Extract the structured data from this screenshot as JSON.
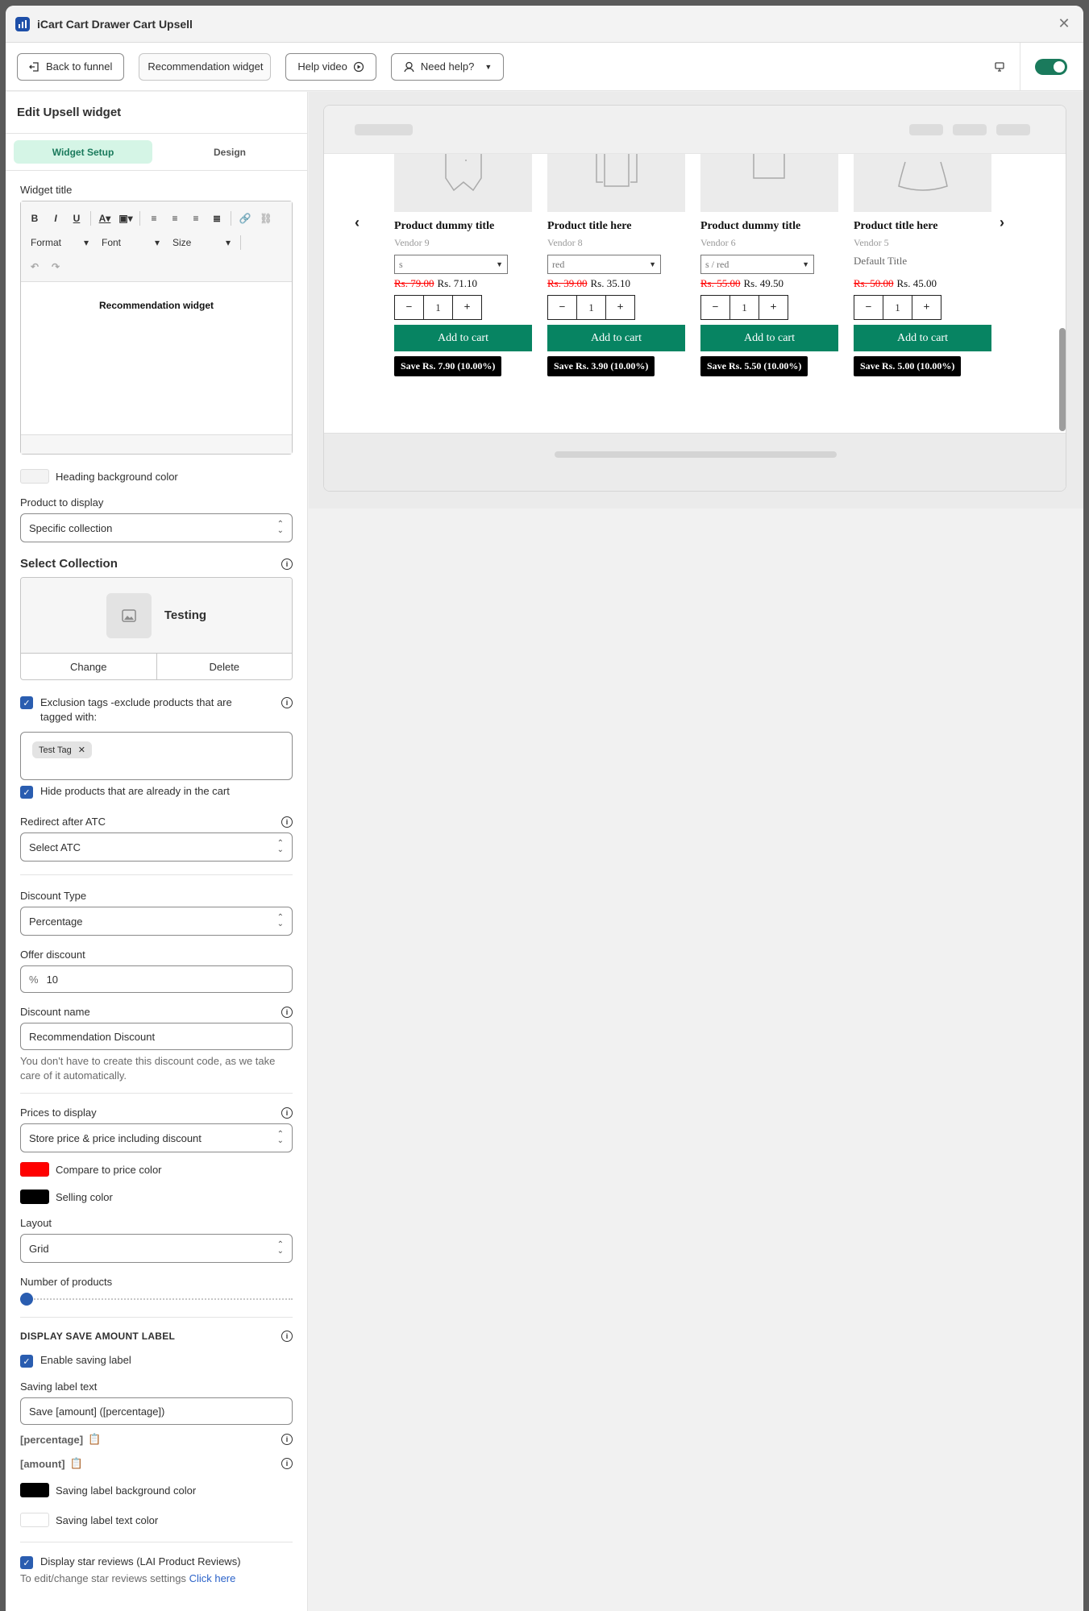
{
  "window": {
    "title": "iCart Cart Drawer Cart Upsell"
  },
  "toolbar": {
    "back": "Back to funnel",
    "widget_name": "Recommendation widget",
    "help_video": "Help video",
    "need_help": "Need help?"
  },
  "sidebar": {
    "heading": "Edit Upsell widget",
    "tabs": [
      "Widget Setup",
      "Design"
    ],
    "widget_title_label": "Widget title",
    "editor": {
      "format": "Format",
      "font": "Font",
      "size": "Size",
      "content": "Recommendation widget"
    },
    "heading_bg_label": "Heading background color",
    "product_display_label": "Product to display",
    "product_display_value": "Specific collection",
    "select_collection_label": "Select Collection",
    "collection_name": "Testing",
    "change": "Change",
    "delete": "Delete",
    "exclusion_label": "Exclusion tags -exclude products that are tagged with:",
    "tag": "Test Tag",
    "hide_products_label": "Hide products that are already in the cart",
    "redirect_label": "Redirect after ATC",
    "redirect_value": "Select ATC",
    "discount_type_label": "Discount Type",
    "discount_type_value": "Percentage",
    "offer_discount_label": "Offer discount",
    "offer_prefix": "%",
    "offer_value": "10",
    "discount_name_label": "Discount name",
    "discount_name_value": "Recommendation Discount",
    "discount_help": "You don't have to create this discount code, as we take care of it automatically.",
    "prices_label": "Prices to display",
    "prices_value": "Store price & price including discount",
    "compare_color_label": "Compare to price color",
    "selling_color_label": "Selling color",
    "layout_label": "Layout",
    "layout_value": "Grid",
    "num_products_label": "Number of products",
    "num_products_level": 0,
    "save_section": "DISPLAY SAVE AMOUNT LABEL",
    "enable_saving_label": "Enable saving label",
    "saving_text_label": "Saving label text",
    "saving_text_value": "Save [amount] ([percentage])",
    "token_percentage": "[percentage]",
    "token_amount": "[amount]",
    "saving_bg_label": "Saving label background color",
    "saving_text_color_label": "Saving label text color",
    "star_reviews_label": "Display star reviews (LAI Product Reviews)",
    "star_help": "To edit/change star reviews settings",
    "star_link": "Click here"
  },
  "colors": {
    "accent": "#1a7a5c",
    "compare": "#ff0000",
    "selling": "#000000",
    "saving_bg": "#000000",
    "saving_text": "#ffffff",
    "heading_bg": "#f3f3f3",
    "atc": "#078462"
  },
  "preview": {
    "prev_arrow": "‹",
    "next_arrow": "›",
    "products": [
      {
        "title": "Product dummy title",
        "vendor": "Vendor 9",
        "variant": "s",
        "compare": "Rs. 79.00",
        "price": "Rs. 71.10",
        "qty": "1",
        "atc": "Add to cart",
        "save": "Save Rs. 7.90 (10.00%)",
        "image_icon": "vest-icon"
      },
      {
        "title": "Product title here",
        "vendor": "Vendor 8",
        "variant": "red",
        "compare": "Rs. 39.00",
        "price": "Rs. 35.10",
        "qty": "1",
        "atc": "Add to cart",
        "save": "Save Rs. 3.90 (10.00%)",
        "image_icon": "shirt-icon"
      },
      {
        "title": "Product dummy title",
        "vendor": "Vendor 6",
        "variant": "s / red",
        "compare": "Rs. 55.00",
        "price": "Rs. 49.50",
        "qty": "1",
        "atc": "Add to cart",
        "save": "Save Rs. 5.50 (10.00%)",
        "image_icon": "tshirt-icon"
      },
      {
        "title": "Product title here",
        "vendor": "Vendor 5",
        "variant": "Default Title",
        "compare": "Rs. 50.00",
        "price": "Rs. 45.00",
        "qty": "1",
        "atc": "Add to cart",
        "save": "Save Rs. 5.00 (10.00%)",
        "image_icon": "dress-icon"
      }
    ]
  }
}
